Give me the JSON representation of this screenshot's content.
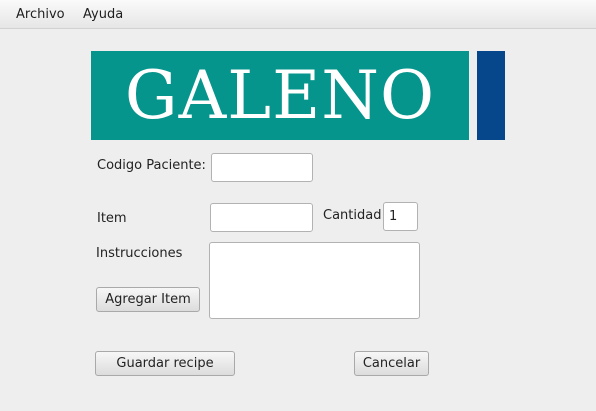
{
  "menu": {
    "archivo": "Archivo",
    "ayuda": "Ayuda"
  },
  "logo": {
    "text": "GALENO",
    "colors": {
      "teal": "#05958c",
      "blue": "#06468b"
    }
  },
  "form": {
    "codigo_paciente_label": "Codigo Paciente:",
    "codigo_paciente_value": "",
    "item_label": "Item",
    "item_value": "",
    "cantidad_label": "Cantidad",
    "cantidad_value": "1",
    "instrucciones_label": "Instrucciones",
    "instrucciones_value": "",
    "agregar_item_label": "Agregar Item",
    "guardar_label": "Guardar recipe",
    "cancelar_label": "Cancelar"
  }
}
